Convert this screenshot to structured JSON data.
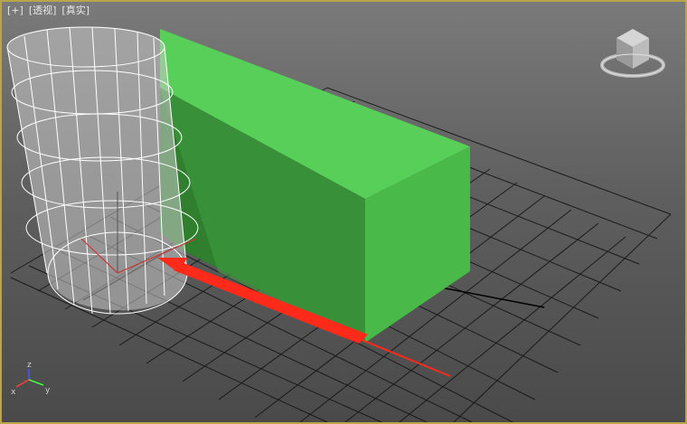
{
  "viewport": {
    "labels": [
      "[+]",
      "[透视]",
      "[真实]"
    ]
  },
  "gizmo": {
    "axis_z": "z",
    "axis_x": "x",
    "axis_y": "y"
  },
  "colors": {
    "viewport_border": "#b9a64a",
    "box_front": "#4bc24b",
    "box_top": "#5bd05b",
    "box_side": "#3a9e3a",
    "arrow": "#ff2a1a",
    "grid": "#111111"
  },
  "icons": {
    "viewcube": "viewcube-icon",
    "axis_tripod": "axis-tripod-icon",
    "pivot_gizmo": "pivot-gizmo-icon"
  }
}
